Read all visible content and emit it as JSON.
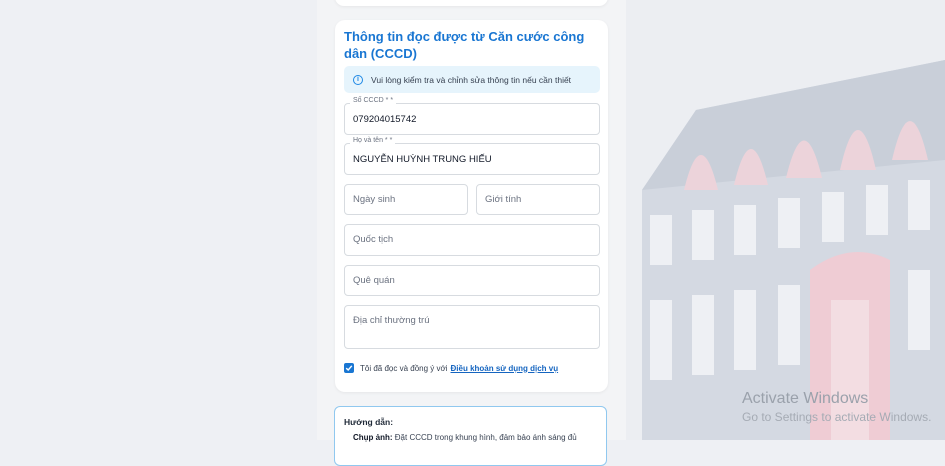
{
  "card": {
    "title": "Thông tin đọc được từ Căn cước công dân (CCCD)"
  },
  "alert": {
    "icon": "info-icon",
    "text": "Vui lòng kiểm tra và chỉnh sửa thông tin nếu cần thiết"
  },
  "fields": {
    "id_number": {
      "label": "Số CCCD * *",
      "value": "079204015742"
    },
    "full_name": {
      "label": "Họ và tên * *",
      "value": "NGUYỄN HUỲNH TRUNG HIẾU"
    },
    "dob": {
      "placeholder": "Ngày sinh"
    },
    "gender": {
      "placeholder": "Giới tính"
    },
    "nationality": {
      "placeholder": "Quốc tịch"
    },
    "hometown": {
      "placeholder": "Quê quán"
    },
    "address": {
      "placeholder": "Địa chỉ thường trú"
    }
  },
  "terms": {
    "checked": true,
    "text": "Tôi đã đọc và đồng ý với",
    "link": "Điều khoản sử dụng dịch vụ"
  },
  "guide": {
    "heading": "Hướng dẫn:",
    "item_label": "Chụp ảnh:",
    "item_text": "Đặt CCCD trong khung hình, đảm bảo ánh sáng đủ"
  },
  "os_watermark": {
    "line1": "Activate Windows",
    "line2": "Go to Settings to activate Windows."
  },
  "colors": {
    "accent": "#1976d2",
    "alert_bg": "#e6f4fc",
    "page_bg": "#eef0f4"
  }
}
